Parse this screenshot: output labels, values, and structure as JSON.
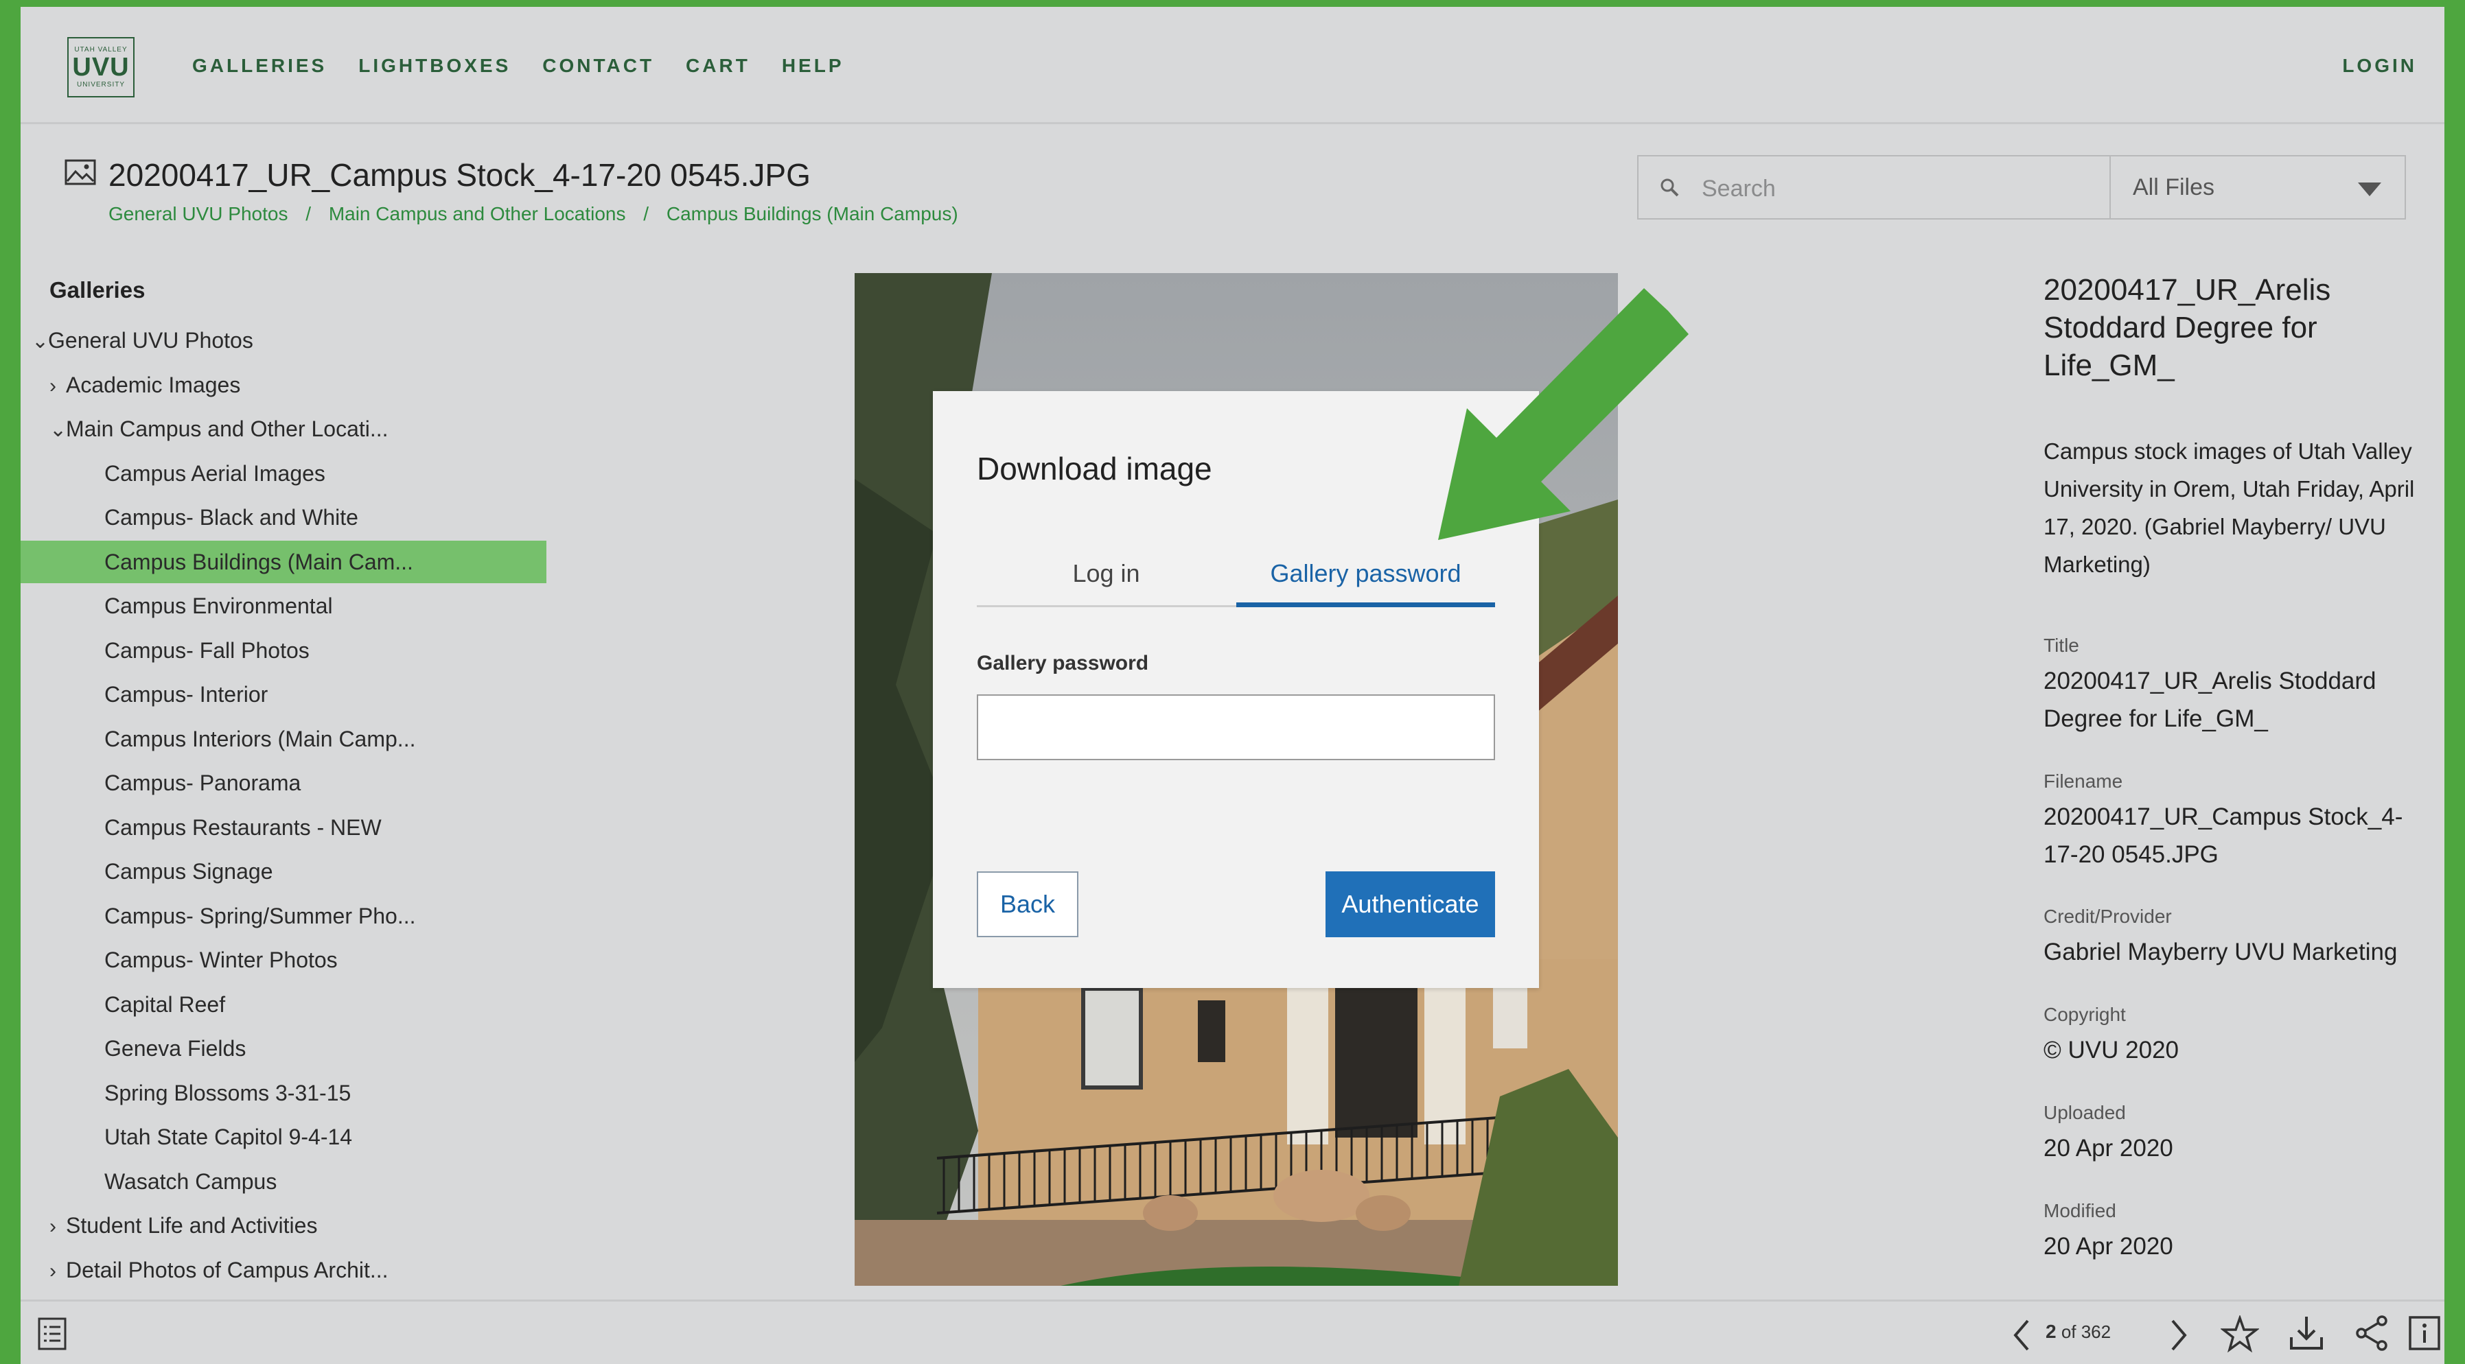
{
  "header": {
    "logo_small": "UTAH VALLEY",
    "logo_big": "UVU",
    "logo_small_bottom": "UNIVERSITY",
    "nav": [
      "GALLERIES",
      "LIGHTBOXES",
      "CONTACT",
      "CART",
      "HELP"
    ],
    "login": "LOGIN"
  },
  "file": {
    "icon": "image-icon",
    "title": "20200417_UR_Campus Stock_4-17-20 0545.JPG",
    "breadcrumb": [
      "General UVU Photos",
      "Main Campus and Other Locations",
      "Campus Buildings (Main Campus)"
    ]
  },
  "search": {
    "placeholder": "Search",
    "filter_value": "All Files"
  },
  "sidebar": {
    "heading": "Galleries",
    "items": [
      {
        "label": "General UVU Photos",
        "chevron": "⌄"
      },
      {
        "label": "Academic Images",
        "chevron": "›"
      },
      {
        "label": "Main Campus and Other Locati...",
        "chevron": "⌄"
      },
      {
        "label": "Campus Aerial Images",
        "chevron": ""
      },
      {
        "label": "Campus- Black and White",
        "chevron": ""
      },
      {
        "label": "Campus Buildings (Main Cam...",
        "chevron": "",
        "active": true
      },
      {
        "label": "Campus Environmental",
        "chevron": ""
      },
      {
        "label": "Campus- Fall Photos",
        "chevron": ""
      },
      {
        "label": "Campus- Interior",
        "chevron": ""
      },
      {
        "label": "Campus Interiors (Main Camp...",
        "chevron": ""
      },
      {
        "label": "Campus- Panorama",
        "chevron": ""
      },
      {
        "label": "Campus Restaurants - NEW",
        "chevron": ""
      },
      {
        "label": "Campus Signage",
        "chevron": ""
      },
      {
        "label": "Campus- Spring/Summer Pho...",
        "chevron": ""
      },
      {
        "label": "Campus- Winter Photos",
        "chevron": ""
      },
      {
        "label": "Capital Reef",
        "chevron": ""
      },
      {
        "label": "Geneva Fields",
        "chevron": ""
      },
      {
        "label": "Spring Blossoms 3-31-15",
        "chevron": ""
      },
      {
        "label": "Utah State Capitol 9-4-14",
        "chevron": ""
      },
      {
        "label": "Wasatch Campus",
        "chevron": ""
      },
      {
        "label": "Student Life and Activities",
        "chevron": "›"
      },
      {
        "label": "Detail Photos of Campus Archit...",
        "chevron": "›"
      }
    ]
  },
  "modal": {
    "title": "Download image",
    "tabs": [
      "Log in",
      "Gallery password"
    ],
    "active_tab": "Gallery password",
    "field_label": "Gallery password",
    "field_value": "",
    "back": "Back",
    "authenticate": "Authenticate"
  },
  "details": {
    "title": "20200417_UR_Arelis Stoddard Degree for Life_GM_",
    "description": "Campus stock images of Utah Valley University in Orem, Utah Friday, April 17, 2020. (Gabriel Mayberry/ UVU Marketing)",
    "meta": [
      {
        "label": "Title",
        "value": "20200417_UR_Arelis Stoddard Degree for Life_GM_"
      },
      {
        "label": "Filename",
        "value": "20200417_UR_Campus Stock_4-17-20 0545.JPG"
      },
      {
        "label": "Credit/Provider",
        "value": "Gabriel Mayberry UVU Marketing"
      },
      {
        "label": "Copyright",
        "value": "© UVU 2020"
      },
      {
        "label": "Uploaded",
        "value": "20 Apr 2020"
      },
      {
        "label": "Modified",
        "value": "20 Apr 2020"
      }
    ]
  },
  "pager": {
    "current": "2",
    "text": "of 362"
  },
  "colors": {
    "frame": "#4ea63f",
    "brand_green": "#2b5e3a",
    "link_green": "#2d8a3e",
    "active_row": "#76c06c",
    "primary_blue": "#2070b8",
    "annotation_arrow": "#4ea63f"
  }
}
